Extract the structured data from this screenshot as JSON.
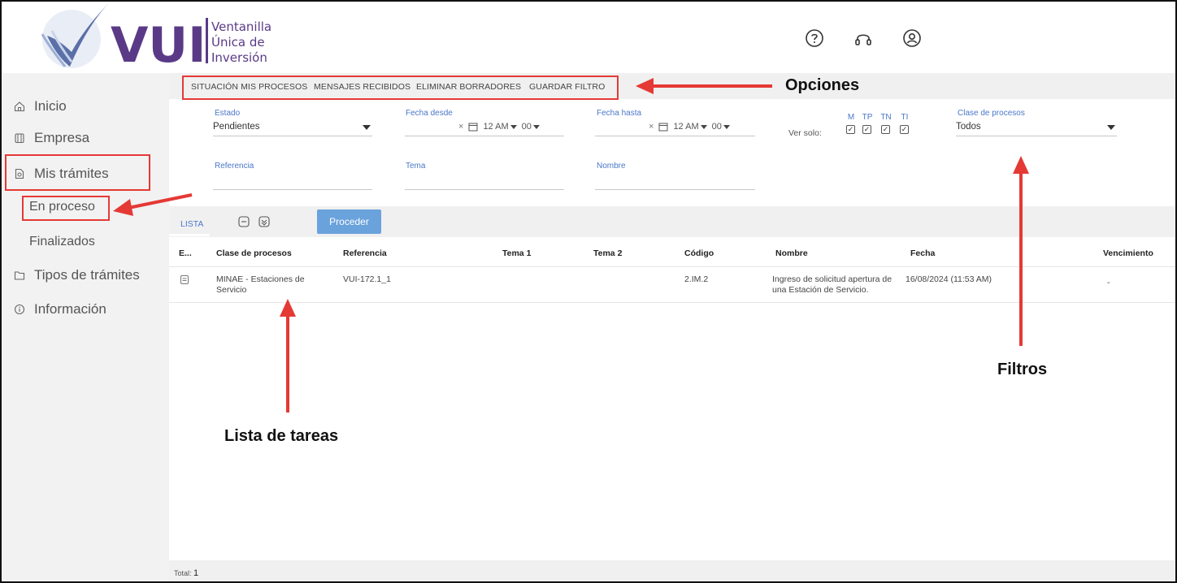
{
  "header": {
    "logo_text": "VUI",
    "tagline": [
      "Ventanilla",
      "Única de",
      "Inversión"
    ],
    "icons": [
      "help-icon",
      "support-headset-icon",
      "user-account-icon"
    ]
  },
  "sidebar": {
    "items": [
      {
        "label": "Inicio",
        "icon": "home-icon"
      },
      {
        "label": "Empresa",
        "icon": "building-icon"
      },
      {
        "label": "Mis trámites",
        "icon": "document-icon"
      },
      {
        "label": "Tipos de trámites",
        "icon": "folder-icon"
      },
      {
        "label": "Información",
        "icon": "info-icon"
      }
    ],
    "subitems": [
      {
        "label": "En proceso"
      },
      {
        "label": "Finalizados"
      }
    ]
  },
  "options": [
    "SITUACIÓN MIS PROCESOS",
    "MENSAJES RECIBIDOS",
    "ELIMINAR BORRADORES",
    "GUARDAR FILTRO"
  ],
  "filters": {
    "estado": {
      "label": "Estado",
      "value": "Pendientes"
    },
    "fecha_desde": {
      "label": "Fecha desde",
      "clear": "×",
      "time": "12 AM",
      "minutes": "00"
    },
    "fecha_hasta": {
      "label": "Fecha hasta",
      "clear": "×",
      "time": "12 AM",
      "minutes": "00"
    },
    "ver_solo": {
      "label": "Ver solo:",
      "options": [
        "M",
        "TP",
        "TN",
        "TI"
      ],
      "check": "✓"
    },
    "clase": {
      "label": "Clase de procesos",
      "value": "Todos"
    },
    "referencia": {
      "label": "Referencia"
    },
    "tema": {
      "label": "Tema"
    },
    "nombre": {
      "label": "Nombre"
    }
  },
  "toolbar": {
    "tab": "LISTA",
    "proceed": "Proceder"
  },
  "table": {
    "columns": [
      "E...",
      "Clase de procesos",
      "Referencia",
      "Tema 1",
      "Tema 2",
      "Código",
      "Nombre",
      "Fecha",
      "Vencimiento"
    ],
    "rows": [
      {
        "clase": "MINAE - Estaciones de Servicio",
        "referencia": "VUI-172.1_1",
        "tema1": "",
        "tema2": "",
        "codigo": "2.IM.2",
        "nombre": "Ingreso de solicitud apertura de una Estación de Servicio.",
        "fecha": "16/08/2024 (11:53 AM)",
        "vencimiento": "-"
      }
    ]
  },
  "footer": {
    "total_label": "Total:",
    "total_value": "1"
  },
  "annotations": {
    "opciones": "Opciones",
    "filtros": "Filtros",
    "lista": "Lista de tareas"
  },
  "colors": {
    "accent": "#4a77c9",
    "button": "#6aa2dc",
    "brand_purple": "#5a3a87",
    "annotation_red": "#e53935"
  }
}
